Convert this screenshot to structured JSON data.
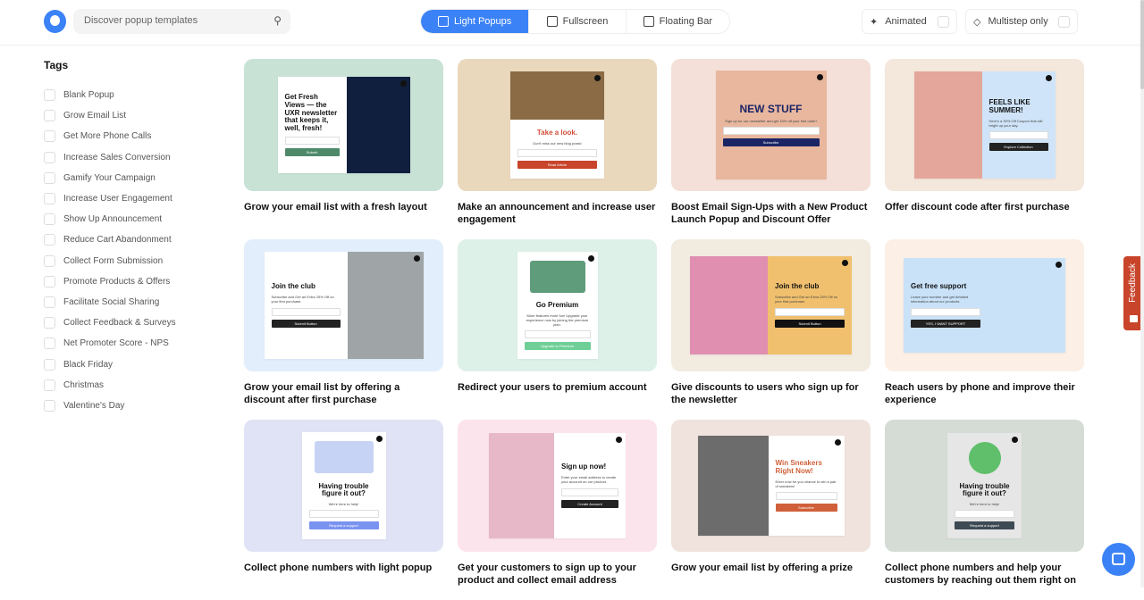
{
  "header": {
    "search_placeholder": "Discover popup templates",
    "tabs": [
      {
        "label": "Light Popups",
        "active": true,
        "icon": "light-popup-icon"
      },
      {
        "label": "Fullscreen",
        "icon": "fullscreen-icon"
      },
      {
        "label": "Floating Bar",
        "icon": "floating-bar-icon"
      }
    ],
    "toggles": [
      {
        "label": "Animated",
        "icon": "sparkle-icon",
        "checked": false
      },
      {
        "label": "Multistep only",
        "icon": "diamond-icon",
        "checked": false
      }
    ]
  },
  "sidebar": {
    "title": "Tags",
    "tags": [
      "Blank Popup",
      "Grow Email List",
      "Get More Phone Calls",
      "Increase Sales Conversion",
      "Gamify Your Campaign",
      "Increase User Engagement",
      "Show Up Announcement",
      "Reduce Cart Abandonment",
      "Collect Form Submission",
      "Promote Products & Offers",
      "Facilitate Social Sharing",
      "Collect Feedback & Surveys",
      "Net Promoter Score - NPS",
      "Black Friday",
      "Christmas",
      "Valentine's Day"
    ]
  },
  "templates": [
    {
      "title": "Grow your email list with a fresh layout",
      "bg": "#c8e2d6",
      "popbg": "#ffffff",
      "img": "right",
      "imgc": "#0f1f3d",
      "heading": "Get Fresh Views — the UXR newsletter that keeps it, well, fresh!",
      "hc": "#111111",
      "button": "Submit",
      "btnc": "#4e8a6a",
      "w": 148,
      "h": 108
    },
    {
      "title": "Make an announcement and increase user engagement",
      "bg": "#ead8bd",
      "popbg": "#ffffff",
      "img": "top",
      "imgc": "#8a6b45",
      "heading": "Take a look.",
      "hc": "#d0503a",
      "sub": "Don't miss our new blog posts!",
      "button": "Read Article",
      "btnc": "#c8442b",
      "w": 105,
      "h": 120
    },
    {
      "title": "Boost Email Sign-Ups with a New Product Launch Popup and Discount Offer",
      "bg": "#f4e0d8",
      "popbg": "#e8b79e",
      "img": "none",
      "heading": "NEW STUFF",
      "hc": "#1b2566",
      "sub": "Sign up for our newsletter and get 15% off your first order!",
      "button": "Subscribe",
      "btnc": "#1b2566",
      "w": 124,
      "h": 122
    },
    {
      "title": "Offer discount code after first purchase",
      "bg": "#f4e7dc",
      "popbg": "#cfe4f8",
      "img": "left",
      "imgc": "#e4a69a",
      "heading": "FEELS LIKE SUMMER!",
      "hc": "#111111",
      "sub": "Here's a 30% Off Coupon that will bright up your day.",
      "button": "Explore Collection",
      "btnc": "#222222",
      "w": 158,
      "h": 120
    },
    {
      "title": "Grow your email list by offering a discount after first purchase",
      "bg": "#e2eefc",
      "popbg": "#ffffff",
      "img": "right",
      "imgc": "#9fa4a6",
      "heading": "Join the club",
      "hc": "#111111",
      "sub": "Subscribe and Get an Extra 25% Off on your first purchase.",
      "button": "Submit Button",
      "btnc": "#222222",
      "w": 178,
      "h": 120
    },
    {
      "title": "Redirect your users to premium account",
      "bg": "#def1e8",
      "popbg": "#ffffff",
      "img": "topsmall",
      "imgc": "#5f9c7b",
      "heading": "Go Premium",
      "hc": "#111111",
      "sub": "More features more fun! Upgrade your experience now by joining the premium plan.",
      "button": "Upgrade to Premium",
      "btnc": "#6fcf97",
      "w": 90,
      "h": 120
    },
    {
      "title": "Give discounts to users who sign up for the newsletter",
      "bg": "#f2ebe0",
      "popbg": "#f0c06e",
      "img": "left",
      "imgc": "#e08fb0",
      "heading": "Join the club",
      "hc": "#111111",
      "sub": "Subscribe and Get an Extra 25% Off on your first purchase.",
      "button": "Submit Button",
      "btnc": "#111111",
      "w": 181,
      "h": 110
    },
    {
      "title": "Reach users by phone and improve their experience",
      "bg": "#fbefe6",
      "popbg": "#c9e2f8",
      "img": "right",
      "imgc": "#c9e2f8",
      "heading": "Get free support",
      "hc": "#111111",
      "sub": "Leave your number and get detailed information about our products.",
      "button": "YES, I WANT SUPPORT",
      "btnc": "#222222",
      "w": 181,
      "h": 106
    },
    {
      "title": "Collect phone numbers with light popup",
      "bg": "#e0e3f5",
      "popbg": "#ffffff",
      "img": "topsmall",
      "imgc": "#c7d3f5",
      "heading": "Having trouble figure it out?",
      "hc": "#111111",
      "sub": "We're here to help!",
      "button": "Request a support",
      "btnc": "#7b93f0",
      "w": 94,
      "h": 120
    },
    {
      "title": "Get your customers to sign up to your product and collect email address",
      "bg": "#fce4ed",
      "popbg": "#ffffff",
      "img": "left",
      "imgc": "#e6b8c8",
      "heading": "Sign up now!",
      "hc": "#111111",
      "sub": "Enter your email address to create your account on our product.",
      "button": "Create Account",
      "btnc": "#222222",
      "w": 153,
      "h": 118
    },
    {
      "title": "Grow your email list by offering a prize",
      "bg": "#f0e2dc",
      "popbg": "#ffffff",
      "img": "left",
      "imgc": "#6c6c6c",
      "heading": "Win Sneakers Right Now!",
      "hc": "#d0603a",
      "sub": "Enter now for you chance to win a pair of sneakers!",
      "button": "Subscribe",
      "btnc": "#d0603a",
      "w": 164,
      "h": 112
    },
    {
      "title": "Collect phone numbers and help your customers by reaching out them right on",
      "bg": "#d5dcd6",
      "popbg": "#e6e6e6",
      "img": "topsmall",
      "imgc": "#5fbf6a",
      "heading": "Having trouble figure it out?",
      "hc": "#111111",
      "sub": "We're here to help!",
      "button": "Request a support",
      "btnc": "#3d4b55",
      "w": 83,
      "h": 118
    }
  ],
  "widgets": {
    "feedback_label": "Feedback"
  },
  "colors": {
    "accent": "#3b82f6",
    "feedback": "#c8442b"
  }
}
